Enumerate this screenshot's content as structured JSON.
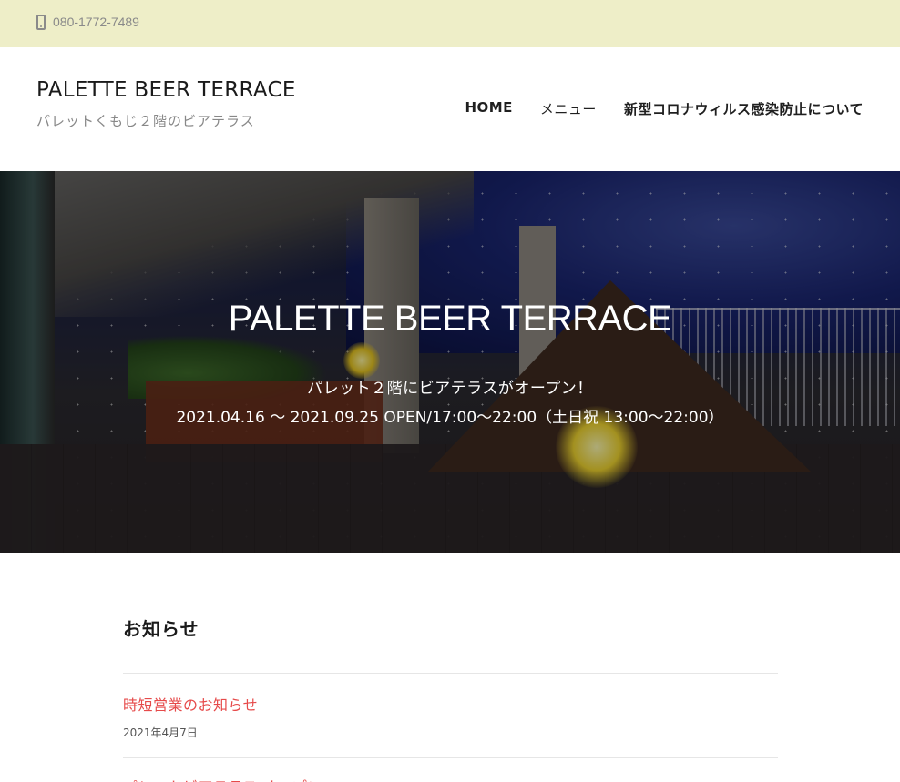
{
  "topbar": {
    "icon": "phone-icon",
    "phone": "080-1772-7489"
  },
  "header": {
    "site_title": "PALETTE BEER TERRACE",
    "tagline": "パレットくもじ２階のビアテラス",
    "nav": [
      {
        "label": "HOME"
      },
      {
        "label": "メニュー"
      },
      {
        "label": "新型コロナウィルス感染防止について"
      }
    ]
  },
  "hero": {
    "title": "PALETTE BEER TERRACE",
    "subtitle": "パレット２階にビアテラスがオープン！",
    "period": "2021.04.16 〜 2021.09.25 OPEN/17:00〜22:00（土日祝 13:00〜22:00）"
  },
  "news": {
    "heading": "お知らせ",
    "items": [
      {
        "title": "時短営業のお知らせ",
        "date": "2021年4月7日"
      },
      {
        "title": "パレットビアテラス オープン",
        "date": ""
      }
    ]
  },
  "colors": {
    "topbar_bg": "#eeeec8",
    "accent_link": "#e64a4a"
  }
}
